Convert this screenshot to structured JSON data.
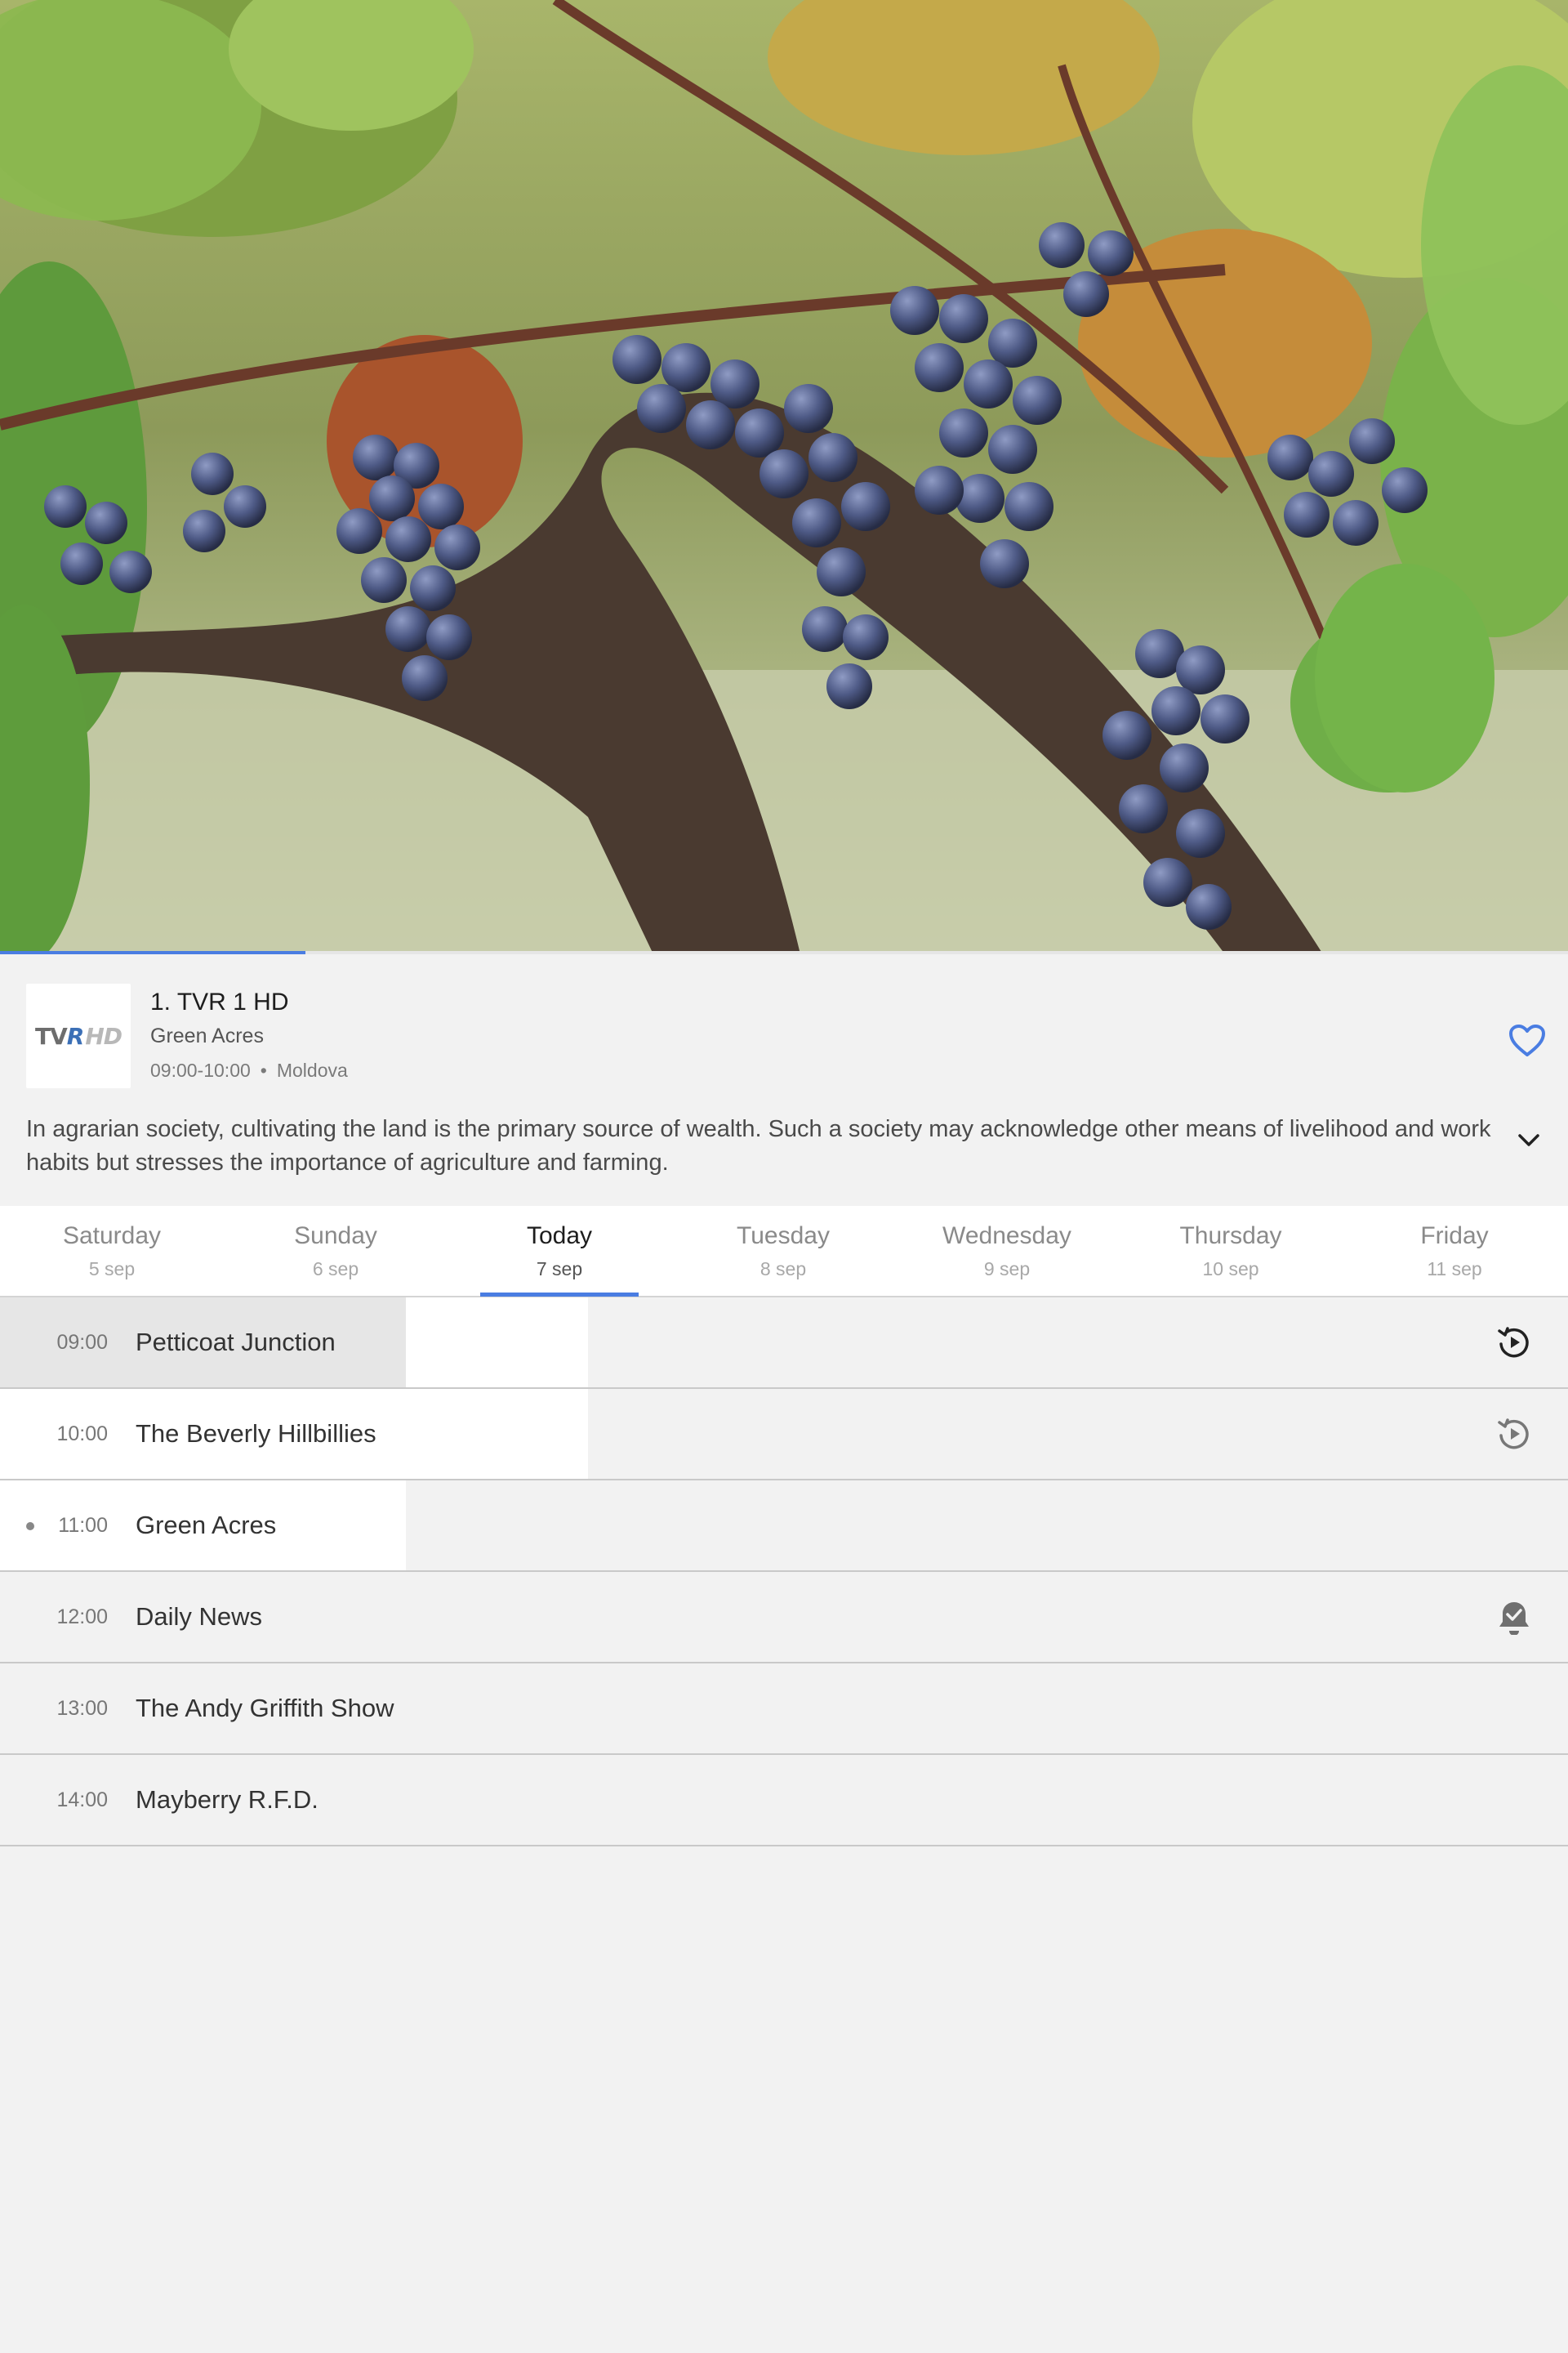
{
  "player": {
    "progress_percent": 19.5,
    "accent_color": "#4a7de2"
  },
  "channel": {
    "logo": {
      "text_main": "TV",
      "text_swoosh": "R",
      "text_hd": "HD",
      "icon": "tvr-hd-logo"
    },
    "name": "1. TVR 1 HD",
    "current_show": "Green Acres",
    "time_range": "09:00-10:00",
    "separator": "•",
    "region": "Moldova",
    "favorite_icon": "heart-outline-icon",
    "description": "In agrarian society, cultivating the land is the primary source of wealth. Such a society may acknowledge other means of livelihood and work habits but stresses the importance of agriculture and farming.",
    "expand_icon": "chevron-down-icon"
  },
  "tabs": [
    {
      "day": "Saturday",
      "date": "5 sep",
      "active": false
    },
    {
      "day": "Sunday",
      "date": "6 sep",
      "active": false
    },
    {
      "day": "Today",
      "date": "7 sep",
      "active": true
    },
    {
      "day": "Tuesday",
      "date": "8 sep",
      "active": false
    },
    {
      "day": "Wednesday",
      "date": "9 sep",
      "active": false
    },
    {
      "day": "Thursday",
      "date": "10 sep",
      "active": false
    },
    {
      "day": "Friday",
      "date": "11 sep",
      "active": false
    }
  ],
  "schedule": [
    {
      "time": "09:00",
      "title": "Petticoat Junction",
      "action_icon": "replay-icon",
      "status": "past"
    },
    {
      "time": "10:00",
      "title": "The Beverly Hillbillies",
      "action_icon": "replay-icon",
      "status": "past"
    },
    {
      "time": "11:00",
      "title": "Green Acres",
      "action_icon": "",
      "status": "live"
    },
    {
      "time": "12:00",
      "title": "Daily News",
      "action_icon": "reminder-set-icon",
      "status": "future"
    },
    {
      "time": "13:00",
      "title": "The Andy Griffith Show",
      "action_icon": "",
      "status": "future"
    },
    {
      "time": "14:00",
      "title": "Mayberry R.F.D.",
      "action_icon": "",
      "status": "future"
    }
  ]
}
